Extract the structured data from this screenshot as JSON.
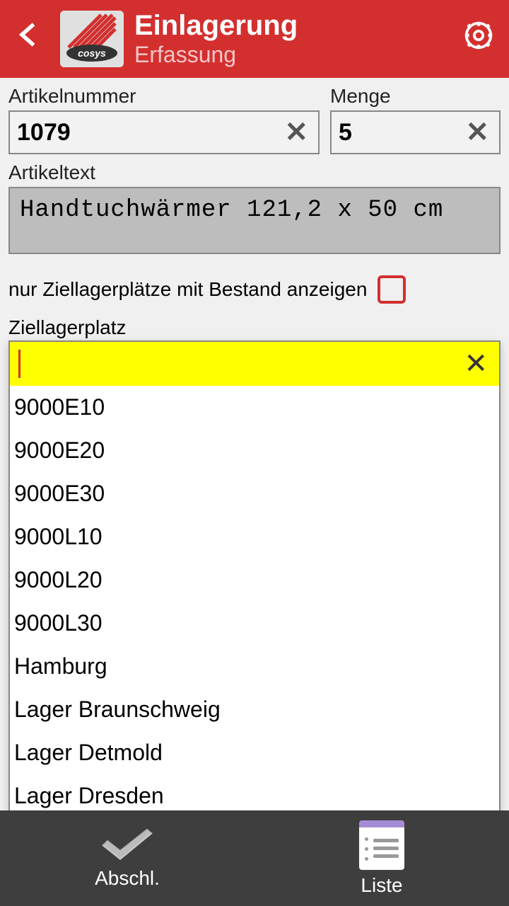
{
  "header": {
    "title": "Einlagerung",
    "subtitle": "Erfassung",
    "logo_text": "cosys"
  },
  "fields": {
    "artikelnummer": {
      "label": "Artikelnummer",
      "value": "1079"
    },
    "menge": {
      "label": "Menge",
      "value": "5"
    },
    "artikeltext": {
      "label": "Artikeltext",
      "value": "Handtuchwärmer 121,2 x 50 cm"
    },
    "checkbox_label": "nur Ziellagerplätze mit Bestand anzeigen",
    "ziellagerplatz": {
      "label": "Ziellagerplatz",
      "value": ""
    }
  },
  "options": [
    "9000E10",
    "9000E20",
    "9000E30",
    "9000L10",
    "9000L20",
    "9000L30",
    "Hamburg",
    "Lager Braunschweig",
    "Lager Detmold",
    "Lager Dresden"
  ],
  "bottom": {
    "abschl": "Abschl.",
    "liste": "Liste"
  }
}
